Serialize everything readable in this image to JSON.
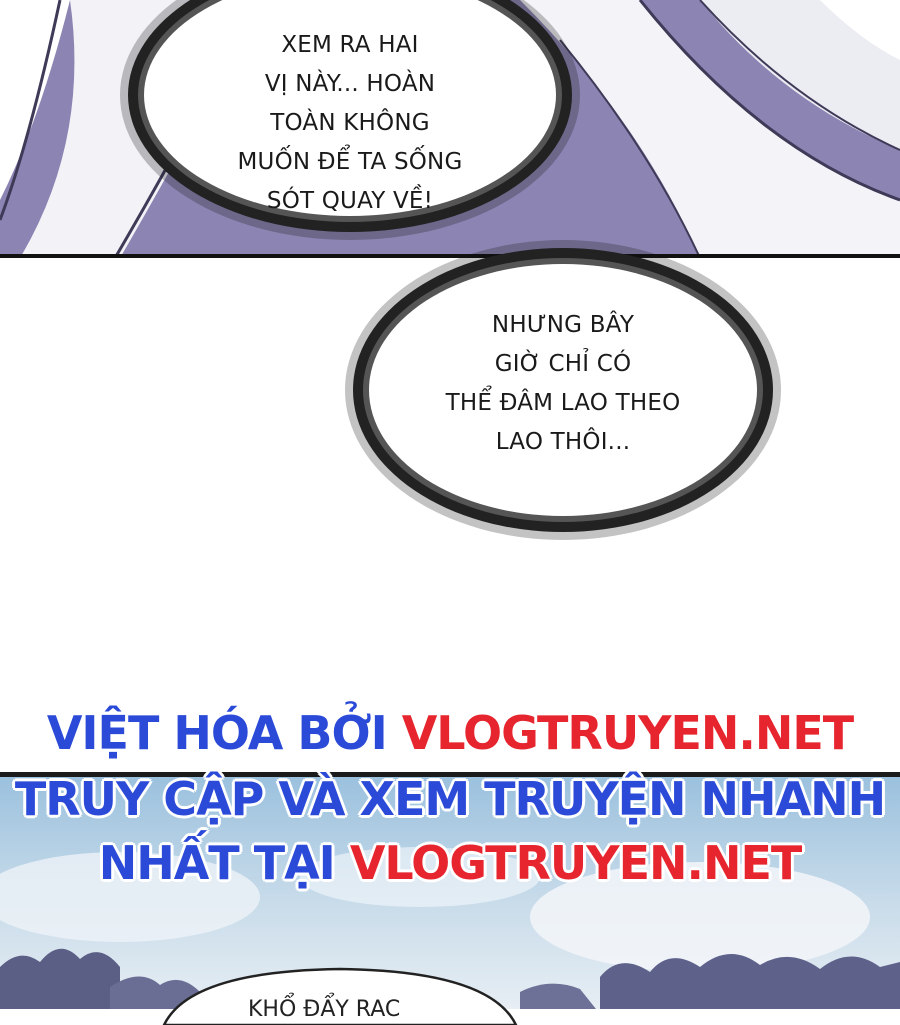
{
  "bubble_1": {
    "lines": [
      "XEM RA HAI",
      "VỊ NÀY... HOÀN",
      "TOÀN KHÔNG",
      "MUỐN ĐỂ TA SỐNG",
      "SÓT QUAY VỀ!"
    ]
  },
  "bubble_2": {
    "lines": [
      "NHƯNG BÂY",
      "GIỜ CHỈ CÓ",
      "THỂ ĐÂM LAO THEO",
      "LAO THÔI..."
    ]
  },
  "credits": {
    "line1_prefix": "VIỆT HÓA BỞI ",
    "line1_site": "VLOGTRUYEN.NET",
    "line2": "TRUY CẬP VÀ XEM TRUYỆN NHANH",
    "line3_prefix": "NHẤT TẠI ",
    "line3_site": "VLOGTRUYEN.NET"
  },
  "bubble_3": {
    "partial_text": "KHỔ ĐẨY RAC"
  },
  "colors": {
    "credit_blue": "#2b4ad8",
    "credit_red": "#e6252e",
    "robe_purple": "#8d86b4",
    "sky_blue": "#9bc1de"
  }
}
